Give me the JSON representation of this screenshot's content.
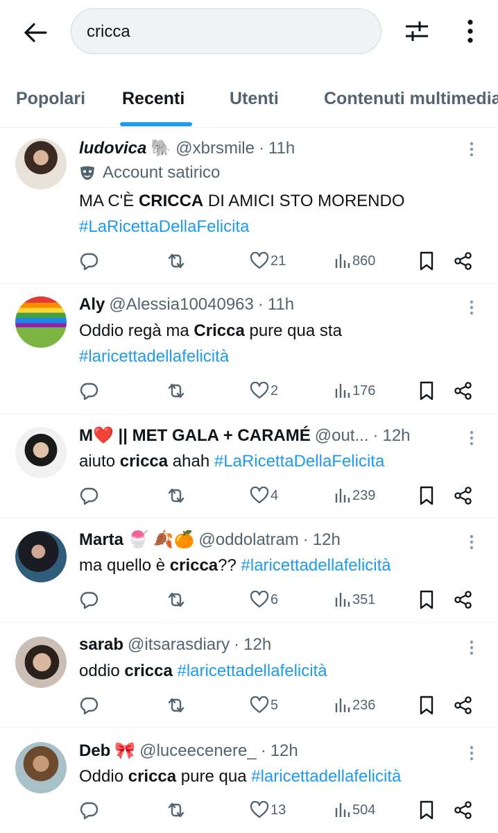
{
  "search": {
    "query": "cricca"
  },
  "tabs": [
    {
      "label": "Popolari"
    },
    {
      "label": "Recenti"
    },
    {
      "label": "Utenti"
    },
    {
      "label": "Contenuti multimedia"
    }
  ],
  "active_tab": "Recenti",
  "colors": {
    "accent": "#1d9bf0",
    "muted": "#536471",
    "text": "#0f1419"
  },
  "tweets": [
    {
      "name": "ludovica",
      "emoji": "🐘",
      "handle": "@xbrsmile",
      "time": "11h",
      "label": "Account satirico",
      "text_parts": [
        "MA C'È ",
        "CRICCA",
        " DI AMICI STO MORENDO"
      ],
      "hashtag": "#LaRicettaDellaFelicita",
      "likes": "21",
      "views": "860"
    },
    {
      "name": "Aly",
      "handle": "@Alessia10040963",
      "time": "11h",
      "text_parts": [
        "Oddio regà ma ",
        "Cricca",
        " pure qua sta"
      ],
      "hashtag": "#laricettadellafelicità",
      "likes": "2",
      "views": "176"
    },
    {
      "name": "M❤️ || MET GALA + CARAMÉ",
      "handle": "@out...",
      "time": "12h",
      "text_parts": [
        "aiuto ",
        "cricca",
        " ahah "
      ],
      "hashtag": "#LaRicettaDellaFelicita",
      "likes": "4",
      "views": "239"
    },
    {
      "name": "Marta",
      "emoji": "🍧 🍂🍊",
      "handle": "@oddolatram",
      "time": "12h",
      "text_parts": [
        "ma quello è ",
        "cricca",
        "?? "
      ],
      "hashtag": "#laricettadellafelicità",
      "likes": "6",
      "views": "351"
    },
    {
      "name": "sarab",
      "handle": "@itsarasdiary",
      "time": "12h",
      "text_parts": [
        "oddio ",
        "cricca",
        " "
      ],
      "hashtag": "#laricettadellafelicità",
      "likes": "5",
      "views": "236"
    },
    {
      "name": "Deb",
      "emoji": "🎀",
      "handle": "@luceecenere_",
      "time": "12h",
      "text_parts": [
        "Oddio ",
        "cricca",
        " pure qua "
      ],
      "hashtag": "#laricettadellafelicità",
      "likes": "13",
      "views": "504"
    }
  ]
}
